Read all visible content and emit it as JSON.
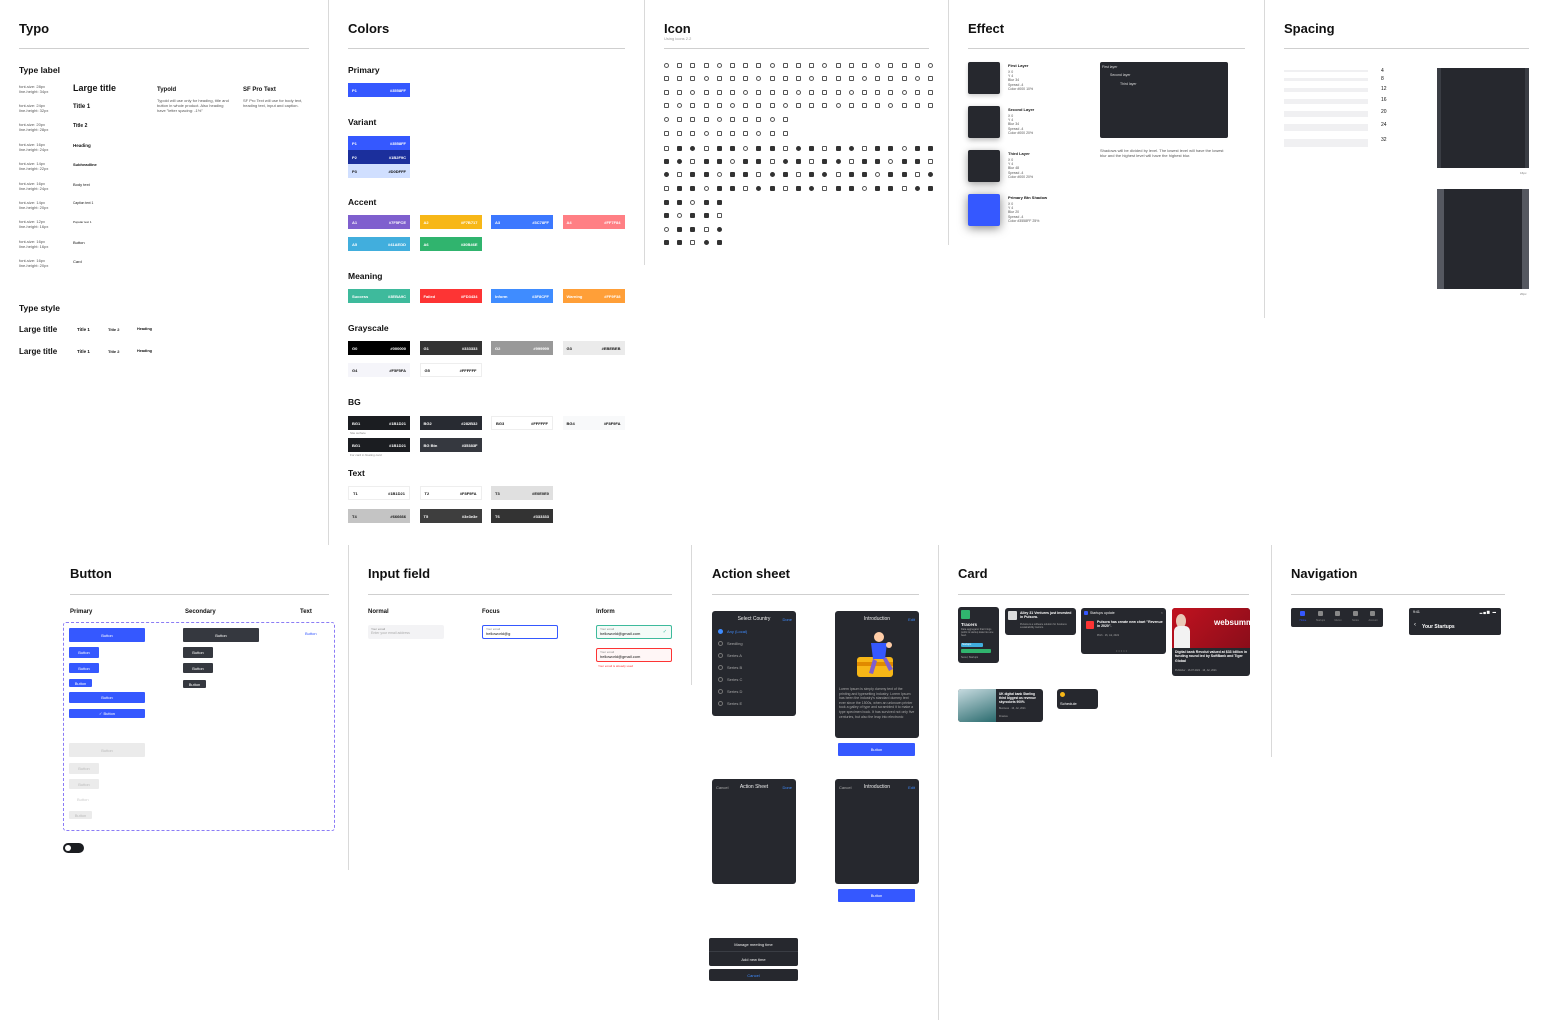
{
  "sections": {
    "typo": "Typo",
    "colors": "Colors",
    "icon": "Icon",
    "effect": "Effect",
    "spacing": "Spacing",
    "button": "Button",
    "input": "Input field",
    "action_sheet": "Action sheet",
    "card": "Card",
    "navigation": "Navigation"
  },
  "typo": {
    "type_label": "Type label",
    "specs": [
      [
        "font-size: 28px",
        "line-height: 34px"
      ],
      [
        "font-size: 24px",
        "line-height: 32px"
      ],
      [
        "font-size: 20px",
        "line-height: 28px"
      ],
      [
        "font-size: 16px",
        "line-height: 24px"
      ],
      [
        "font-size: 14px",
        "line-height: 22px"
      ],
      [
        "font-size: 16px",
        "line-height: 24px"
      ],
      [
        "font-size: 14px",
        "line-height: 20px"
      ],
      [
        "font-size: 12px",
        "line-height: 16px"
      ],
      [
        "font-size: 16px",
        "line-height: 16px"
      ],
      [
        "font-size: 16px",
        "line-height: 20px"
      ]
    ],
    "names": [
      "Large title",
      "Title 1",
      "Title 2",
      "Heading",
      "Subheadline",
      "Body text",
      "Caption text 1",
      "Popular text 1",
      "Button",
      "Card"
    ],
    "typold_title": "Typold",
    "typold_desc": "Typold will use only for heading, title and button in whole product. Also heading have \"letter spacing: -1%\"",
    "sf_title": "SF Pro Text",
    "sf_desc": "SF Pro Text will use for body text, heading text, input and caption.",
    "type_style": "Type style",
    "styles": [
      "Large title",
      "Title 1",
      "Title 2",
      "Heading"
    ]
  },
  "colors": {
    "primary": "Primary",
    "primary_swatch": {
      "name": "P1",
      "hex": "#3558FF",
      "color": "#3558FF"
    },
    "variant": "Variant",
    "variants": [
      {
        "name": "P1",
        "hex": "#3558FF",
        "color": "#3558FF"
      },
      {
        "name": "P2",
        "hex": "#1B2F9C",
        "color": "#1B2F9C"
      },
      {
        "name": "P3",
        "hex": "#D0DFFF",
        "color": "#D0DFFF"
      }
    ],
    "accent": "Accent",
    "accents": [
      {
        "name": "A1",
        "hex": "#7F5FCE",
        "color": "#7F5FCE"
      },
      {
        "name": "A2",
        "hex": "#F7B717",
        "color": "#F7B717"
      },
      {
        "name": "A3",
        "hex": "#3C78FF",
        "color": "#3C78FF"
      },
      {
        "name": "A4",
        "hex": "#FF7F84",
        "color": "#FF7F84"
      },
      {
        "name": "A5",
        "hex": "#41AEDD",
        "color": "#41AEDD"
      },
      {
        "name": "A6",
        "hex": "#30B46E",
        "color": "#30B46E"
      }
    ],
    "meaning": "Meaning",
    "meanings": [
      {
        "name": "Success",
        "hex": "#3EBA9C",
        "color": "#3EBA9C"
      },
      {
        "name": "Failed",
        "hex": "#FD3434",
        "color": "#FD3434"
      },
      {
        "name": "Inform",
        "hex": "#3F8CFF",
        "color": "#3F8CFF"
      },
      {
        "name": "Warning",
        "hex": "#FF9F38",
        "color": "#FF9F38"
      }
    ],
    "grayscale": "Grayscale",
    "grays": [
      {
        "name": "G0",
        "hex": "#000000",
        "color": "#000000"
      },
      {
        "name": "G1",
        "hex": "#333333",
        "color": "#333333"
      },
      {
        "name": "G2",
        "hex": "#999999",
        "color": "#999999"
      },
      {
        "name": "G3",
        "hex": "#EBEBEB",
        "color": "#EBEBEB"
      },
      {
        "name": "G4",
        "hex": "#F5F5FA",
        "color": "#F5F5FA"
      },
      {
        "name": "G5",
        "hex": "#FFFFFF",
        "color": "#FFFFFF"
      }
    ],
    "bg": "BG",
    "bgs": [
      {
        "name": "BG1",
        "hex": "#1B1D21",
        "color": "#1B1D21"
      },
      {
        "name": "BG2",
        "hex": "#282B32",
        "color": "#282B32"
      },
      {
        "name": "BG3",
        "hex": "#FFFFFF",
        "color": "#FFFFFF"
      },
      {
        "name": "BG4",
        "hex": "#F8F9FA",
        "color": "#F8F9FA"
      },
      {
        "name": "BG1",
        "hex": "#1B1D21",
        "color": "#1B1D21"
      },
      {
        "name": "BG Btn",
        "hex": "#35383F",
        "color": "#35383F"
      }
    ],
    "bg_note1": "Site surface",
    "bg_note2": "For card in floating card",
    "text": "Text",
    "texts": [
      {
        "name": "T1",
        "hex": "#1B1D21",
        "color": "#FFFFFF"
      },
      {
        "name": "T2",
        "hex": "#F8F9FA",
        "color": "#FFFFFF"
      },
      {
        "name": "T3",
        "hex": "#E0E0E0",
        "color": "#E0E0E0"
      },
      {
        "name": "T4",
        "hex": "#666666",
        "color": "#C4C4C4"
      },
      {
        "name": "T5",
        "hex": "#3e3e3e",
        "color": "#3E3E3E"
      },
      {
        "name": "T6",
        "hex": "#333333",
        "color": "#333333"
      }
    ]
  },
  "icon": {
    "subtitle": "Using icons 2.2"
  },
  "effect": {
    "layers": [
      {
        "title": "First Layer",
        "lines": "X 0\nY 4\nBlur 34\nSpread -4\nColor #000 10%"
      },
      {
        "title": "Second Layer",
        "lines": "X 0\nY 4\nBlur 34\nSpread -4\nColor #000 20%"
      },
      {
        "title": "Third Layer",
        "lines": "X 0\nY 4\nBlur 48\nSpread -4\nColor #000 20%"
      },
      {
        "title": "Primary Btn Shadow",
        "lines": "X 0\nY 4\nBlur 20\nSpread -4\nColor #3558FF 25%"
      }
    ],
    "stack_labels": [
      "First layer",
      "Second layer",
      "Third layer"
    ],
    "desc": "Shadows will be divided by level. The lowest level will have the lowest blur and the highest level will have the highest blur."
  },
  "spacing": {
    "values": [
      "4",
      "8",
      "12",
      "16",
      "20",
      "24",
      "32"
    ],
    "label1": "16px",
    "label2": "20px"
  },
  "button": {
    "primary": "Primary",
    "secondary": "Secondary",
    "text": "Text",
    "label": "Button",
    "check_label": "✓ Button"
  },
  "input": {
    "normal": "Normal",
    "focus": "Focus",
    "inform": "Inform",
    "label": "Your email",
    "placeholder": "Enter your email address",
    "value": "helloworld@g",
    "inform_value": "helloworld@gmail.com",
    "error_value": "helloworld@gmail.com",
    "error_msg": "Your email is already used"
  },
  "action_sheet": {
    "select_title": "Select Country",
    "select_action": "Done",
    "options": [
      "Any (Local)",
      "Seedling",
      "Series A",
      "Series B",
      "Series C",
      "Series D",
      "Series E"
    ],
    "intro_title": "Introduction",
    "intro_action": "Edit",
    "intro_body": "Lorem Ipsum is simply dummy text of the printing and typesetting industry. Lorem Ipsum has been the industry's standard dummy text ever since the 1500s, when an unknown printer took a galley of type and scrambled it to make a type specimen book. It has survived not only five centuries, but also the leap into electronic",
    "btn": "Button",
    "cancel": "Cancel",
    "sheet_title": "Action Sheet",
    "sheet_done": "Done",
    "intro2_title": "Introduction",
    "intro2_action": "Edit",
    "menu": [
      "Manage meeting time",
      "Add new time"
    ],
    "menu_cancel": "Cancel"
  },
  "card": {
    "tracers_title": "Tracers",
    "tracers_desc": "Data aggregator that brings public & startup data into one feed.",
    "tracers_tag": "Startups",
    "tracers_foot": "Seoul, Startups",
    "news1": "Alley 31 Ventures just invested in Pulsora.",
    "news1_sub": "Pulsora is a software solution for business sustainability metrics.",
    "update_title": "Startups update",
    "update_text": "Pulsora has create new chart \"Revenue in 2020\".",
    "update_sub": "Pitch · 16, Jul, 2021",
    "hero_caption": "Digital bank Revolut valued at $33 billion in funding round led by SoftBank and Tiger Global",
    "hero_sub": "Publisher · 16.07.2021 · 16, Jul, 2021",
    "hero_banner": "websummit",
    "news2": "UK digital bank Starling third biggest as revenue skyrockets 900%",
    "news2_sub": "Business · 16, Jul, 2021",
    "news2_foot": "Finance",
    "schedule": "Schedule"
  },
  "navigation": {
    "tabs": [
      "Home",
      "Startups",
      "Memo",
      "Notice",
      "Account"
    ],
    "time": "9:41",
    "back_title": "Your Startups"
  }
}
